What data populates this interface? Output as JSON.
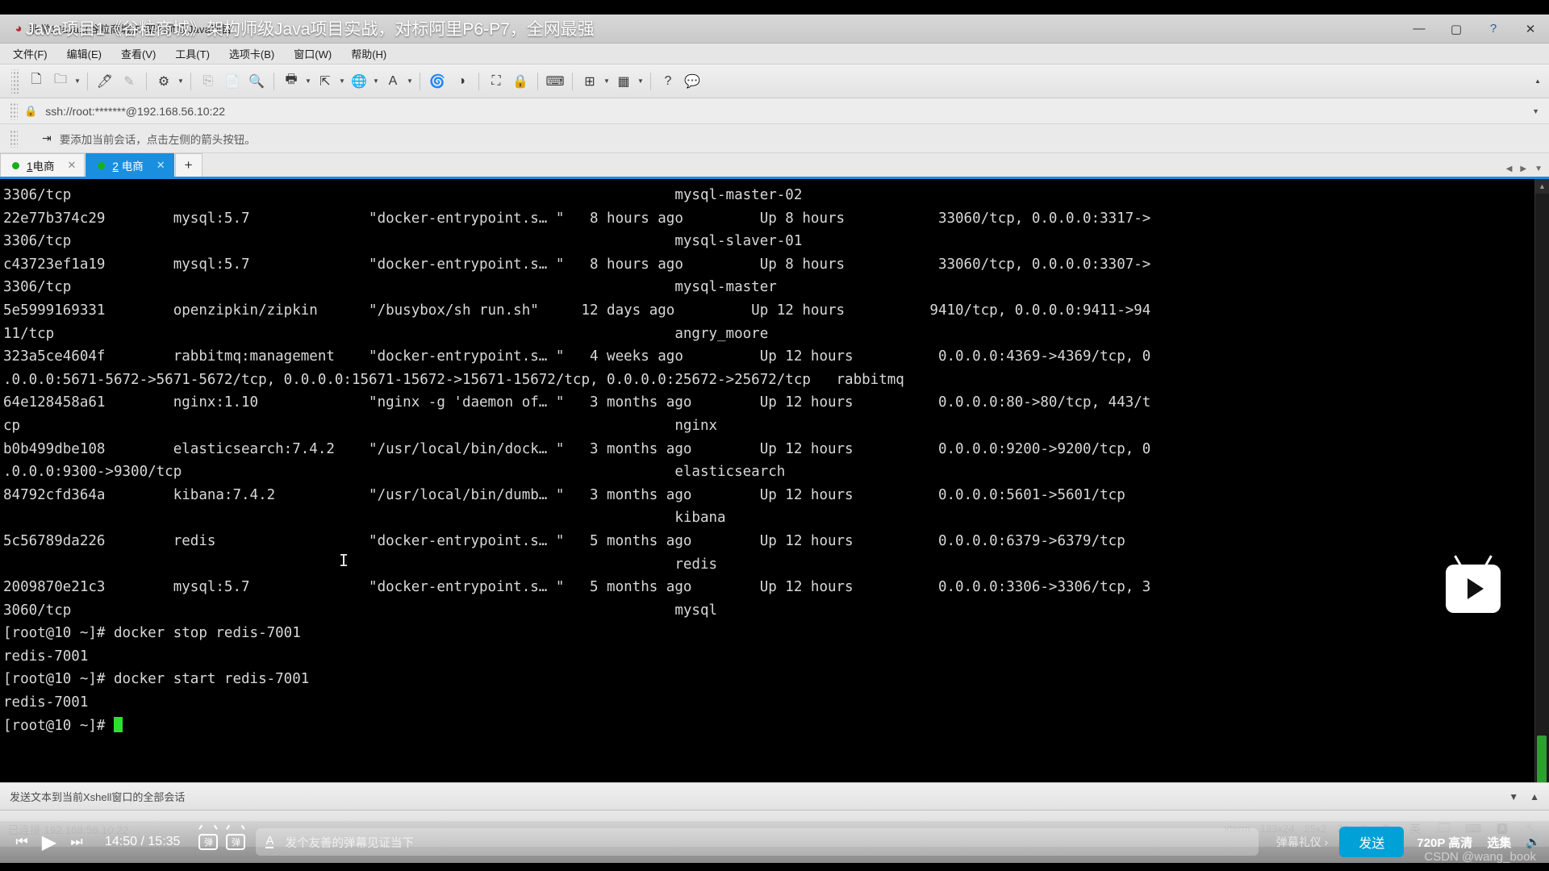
{
  "window": {
    "xshell_title": "非常1Java1(谷粒商城)Fr架构师级Java项目",
    "app_icon": "xshell-icon",
    "minimize": "—",
    "maximize": "▢",
    "help": "?",
    "close": "✕"
  },
  "overlay": {
    "video_title": "Java项目1《谷粒商城》架构师级Java项目实战，对标阿里P6-P7，全网最强"
  },
  "menu": {
    "items": [
      {
        "label": "文件(F)",
        "name": "menu-file"
      },
      {
        "label": "编辑(E)",
        "name": "menu-edit"
      },
      {
        "label": "查看(V)",
        "name": "menu-view"
      },
      {
        "label": "工具(T)",
        "name": "menu-tools"
      },
      {
        "label": "选项卡(B)",
        "name": "menu-tabs"
      },
      {
        "label": "窗口(W)",
        "name": "menu-window"
      },
      {
        "label": "帮助(H)",
        "name": "menu-help"
      }
    ]
  },
  "toolbar": {
    "buttons": [
      {
        "glyph": "🗋",
        "name": "new-session-icon"
      },
      {
        "glyph": "🗀",
        "name": "open-folder-icon",
        "caret": true
      },
      {
        "glyph": "🖊",
        "name": "edit-session-icon"
      },
      {
        "glyph": "✎",
        "name": "write-icon",
        "dim": true
      },
      {
        "glyph": "⚙",
        "name": "session-properties-icon",
        "caret": true
      },
      {
        "glyph": "⎘",
        "name": "copy-icon",
        "dim": true
      },
      {
        "glyph": "📄",
        "name": "paste-icon",
        "dim": true
      },
      {
        "glyph": "🔍",
        "name": "find-icon"
      },
      {
        "glyph": "🖶",
        "name": "print-icon",
        "caret": true
      },
      {
        "glyph": "⇱",
        "name": "transfer-icon",
        "caret": true
      },
      {
        "glyph": "🌐",
        "name": "globe-icon",
        "caret": true
      },
      {
        "glyph": "A",
        "name": "font-icon",
        "caret": true
      },
      {
        "glyph": "🌀",
        "name": "xftp-icon"
      },
      {
        "glyph": "◑",
        "name": "xagent-icon"
      },
      {
        "glyph": "⛶",
        "name": "fullscreen-icon"
      },
      {
        "glyph": "🔒",
        "name": "lock-icon"
      },
      {
        "glyph": "⌨",
        "name": "keyboard-icon"
      },
      {
        "glyph": "⊞",
        "name": "new-window-icon",
        "caret": true
      },
      {
        "glyph": "▦",
        "name": "layout-icon",
        "caret": true
      },
      {
        "glyph": "?",
        "name": "help-icon"
      },
      {
        "glyph": "💬",
        "name": "feedback-icon"
      }
    ],
    "scroll_up": "▲",
    "scroll_down": "▼"
  },
  "addressbar": {
    "lock_icon": "🔒",
    "url": "ssh://root:*******@192.168.56.10:22",
    "dropdown": "▼"
  },
  "hintbar": {
    "icon": "⇥",
    "text": "要添加当前会话，点击左侧的箭头按钮。"
  },
  "tabs": {
    "items": [
      {
        "index": "1",
        "label": "电商",
        "active": false,
        "close": "✕",
        "dot_color": "#18b018"
      },
      {
        "index": "2",
        "label": "电商",
        "active": true,
        "close": "✕",
        "dot_color": "#18e018"
      }
    ],
    "add": "+",
    "nav_left": "◀",
    "nav_right": "▶",
    "nav_menu": "▼"
  },
  "terminal": {
    "prompt_user": "root",
    "lines": [
      "3306/tcp                                                                       mysql-master-02",
      "22e77b374c29        mysql:5.7              \"docker-entrypoint.s… \"   8 hours ago         Up 8 hours           33060/tcp, 0.0.0.0:3317->",
      "3306/tcp                                                                       mysql-slaver-01",
      "c43723ef1a19        mysql:5.7              \"docker-entrypoint.s… \"   8 hours ago         Up 8 hours           33060/tcp, 0.0.0.0:3307->",
      "3306/tcp                                                                       mysql-master",
      "5e5999169331        openzipkin/zipkin      \"/busybox/sh run.sh\"     12 days ago         Up 12 hours          9410/tcp, 0.0.0.0:9411->94",
      "11/tcp                                                                         angry_moore",
      "323a5ce4604f        rabbitmq:management    \"docker-entrypoint.s… \"   4 weeks ago         Up 12 hours          0.0.0.0:4369->4369/tcp, 0",
      ".0.0.0:5671-5672->5671-5672/tcp, 0.0.0.0:15671-15672->15671-15672/tcp, 0.0.0.0:25672->25672/tcp   rabbitmq",
      "64e128458a61        nginx:1.10             \"nginx -g 'daemon of… \"   3 months ago        Up 12 hours          0.0.0.0:80->80/tcp, 443/t",
      "cp                                                                             nginx",
      "b0b499dbe108        elasticsearch:7.4.2    \"/usr/local/bin/dock… \"   3 months ago        Up 12 hours          0.0.0.0:9200->9200/tcp, 0",
      ".0.0.0:9300->9300/tcp                                                          elasticsearch",
      "84792cfd364a        kibana:7.4.2           \"/usr/local/bin/dumb… \"   3 months ago        Up 12 hours          0.0.0.0:5601->5601/tcp",
      "                                                                               kibana",
      "5c56789da226        redis                  \"docker-entrypoint.s… \"   5 months ago        Up 12 hours          0.0.0.0:6379->6379/tcp",
      "                                                                               redis",
      "2009870e21c3        mysql:5.7              \"docker-entrypoint.s… \"   5 months ago        Up 12 hours          0.0.0.0:3306->3306/tcp, 3",
      "3060/tcp                                                                       mysql",
      "[root@10 ~]# docker stop redis-7001",
      "redis-7001",
      "[root@10 ~]# docker start redis-7001",
      "redis-7001"
    ],
    "last_prompt": "[root@10 ~]# ",
    "cursor": "block",
    "mouse_caret": "I"
  },
  "statusbar": {
    "text": "发送文本到当前Xshell窗口的全部会话",
    "connection": "已连接 192.168.56.10:22",
    "term_type": "xterm",
    "size": "133x24",
    "cursor_pos": "25x2",
    "sessions": "24,",
    "extra": "2"
  },
  "player": {
    "prev": "⏮",
    "play": "▶",
    "next": "⏭",
    "time_current": "14:50",
    "time_sep": "/",
    "time_total": "15:35",
    "danmaku_toggle_label": "弹",
    "danmaku_settings_label": "弹",
    "input_icon": "A",
    "input_placeholder": "发个友善的弹幕见证当下",
    "etiquette": "弹幕礼仪 ›",
    "send": "发送",
    "quality": "720P 高清",
    "episodes": "选集",
    "volume_icon": "🔊",
    "send_color": "#00a1d6"
  },
  "watermark": {
    "text": "CSDN @wang_book"
  },
  "ime": {
    "items": [
      {
        "glyph": "⚙",
        "name": "sogou-logo-icon"
      },
      {
        "glyph": "英",
        "name": "ime-language-icon"
      },
      {
        "glyph": "🗔",
        "name": "ime-panel-icon"
      },
      {
        "glyph": "⌨",
        "name": "ime-keyboard-icon"
      },
      {
        "glyph": "🅰",
        "name": "ime-input-icon"
      },
      {
        "glyph": "🔧",
        "name": "ime-tools-icon"
      }
    ]
  }
}
